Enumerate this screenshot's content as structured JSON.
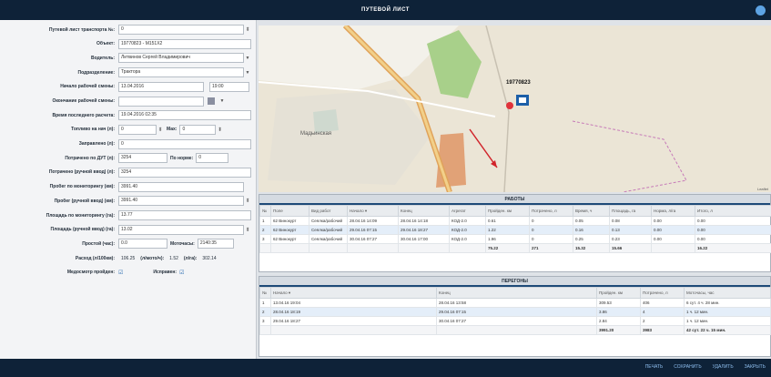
{
  "window": {
    "title": "ПУТЕВОЙ ЛИСТ"
  },
  "form": {
    "waybill_no": {
      "label": "Путевой лист транспорта №:",
      "value": "0"
    },
    "object": {
      "label": "Объект:",
      "value": "19770823 - M151X2"
    },
    "driver": {
      "label": "Водитель:",
      "value": "Литвинов Сергей Владимирович"
    },
    "division": {
      "label": "Подразделение:",
      "value": "Трактора"
    },
    "shift_start": {
      "label": "Начало рабочей смены:",
      "date": "13.04.2016",
      "time": "19:00"
    },
    "shift_end": {
      "label": "Окончание рабочей смены:",
      "value": ""
    },
    "last_calc": {
      "label": "Время последнего расчета:",
      "value": "19.04.2016 02:35"
    },
    "fuel_start": {
      "label": "Топливо на нач (л):",
      "value": "0",
      "max_label": "Мах:",
      "max_value": "0"
    },
    "refueled": {
      "label": "Заправлено (л):",
      "value": "0"
    },
    "spent_dut": {
      "label": "Потрачено по ДУТ (л):",
      "value": "3254",
      "norm_label": "По норме:",
      "norm_value": "0"
    },
    "spent_manual": {
      "label": "Потрачено (ручной ввод) (л):",
      "value": "3254"
    },
    "mileage_mon": {
      "label": "Пробег по мониторингу (км):",
      "value": "3991.40"
    },
    "mileage_manual": {
      "label": "Пробег (ручной ввод) (км):",
      "value": "3991.40"
    },
    "area_mon": {
      "label": "Площадь по мониторингу (га):",
      "value": "13.77"
    },
    "area_manual": {
      "label": "Площадь (ручной ввод) (га):",
      "value": "13.02"
    },
    "idle": {
      "label": "Простой (час):",
      "value": "0.0",
      "hours_label": "Моточасы:",
      "hours_value": "2140:35"
    },
    "consumption": {
      "label": "Расход (л/100км):",
      "value": "106.25",
      "per_hour_label": "(л/мото/ч):",
      "per_hour_value": "1.52",
      "per_ha_label": "(л/га):",
      "per_ha_value": "302.14"
    },
    "medical": {
      "label": "Медосмотр пройден:",
      "check": "☑",
      "serviceable_label": "Исправен:",
      "serviceable_check": "☑"
    }
  },
  "map": {
    "vehicle_label": "19770823",
    "place_label": "Мадьинская",
    "attribution": "Leaflet"
  },
  "works": {
    "title": "РАБОТЫ",
    "columns": [
      "№",
      "Поле",
      "Вид работ",
      "Начало ▾",
      "Конец",
      "Агрегат",
      "Пройден. км",
      "Потрачено, л",
      "Время, ч",
      "Площадь, га",
      "Норма, л/га",
      "Итого, л"
    ],
    "rows": [
      [
        "1",
        "62 Винокурт",
        "Сеялка/рабочий",
        "28.04.16 14:09",
        "28.04.16 14:18",
        "КОД-2.0",
        "0.61",
        "0",
        "0.05",
        "0.08",
        "0.00",
        "0.00"
      ],
      [
        "2",
        "62 Винокурт",
        "Сеялка/рабочий",
        "29.04.16 07:15",
        "29.04.16 18:27",
        "КОД-2.0",
        "1.22",
        "0",
        "0.16",
        "0.13",
        "0.00",
        "0.00"
      ],
      [
        "3",
        "62 Винокурт",
        "Сеялка/рабочий",
        "30.04.16 07:27",
        "30.04.16 17:00",
        "КОД-2.0",
        "1.96",
        "0",
        "0.25",
        "0.23",
        "0.00",
        "0.00"
      ]
    ],
    "total": [
      "",
      "",
      "",
      "",
      "",
      "",
      "75.22",
      "271",
      "15.32",
      "15.66",
      "",
      "16.22"
    ]
  },
  "transfers": {
    "title": "ПЕРЕГОНЫ",
    "columns": [
      "№",
      "Начало ▾",
      "Конец",
      "Пройден. км",
      "Потрачено, л",
      "Моточасы, час"
    ],
    "rows": [
      [
        "1",
        "13.04.16 19:04",
        "28.04.16 13:58",
        "309.53",
        "406",
        "6 сут. 4 ч. 28 мин."
      ],
      [
        "2",
        "28.04.16 18:19",
        "29.04.16 07:15",
        "3.86",
        "4",
        "1 ч. 12 мин."
      ],
      [
        "3",
        "29.04.16 18:27",
        "30.04.16 07:27",
        "2.84",
        "2",
        "1 ч. 12 мин."
      ]
    ],
    "total": [
      "",
      "",
      "",
      "3991.20",
      "3983",
      "42 сут. 22 ч. 15 мин."
    ]
  },
  "footer": {
    "print_label": "ПЕЧАТЬ",
    "save_label": "СОХРАНИТЬ",
    "delete_label": "УДАЛИТЬ",
    "close_label": "ЗАКРЫТЬ"
  },
  "colors": {
    "header_bg": "#0e2238",
    "accent": "#1e4a78",
    "button_text": "#8fbff0"
  }
}
